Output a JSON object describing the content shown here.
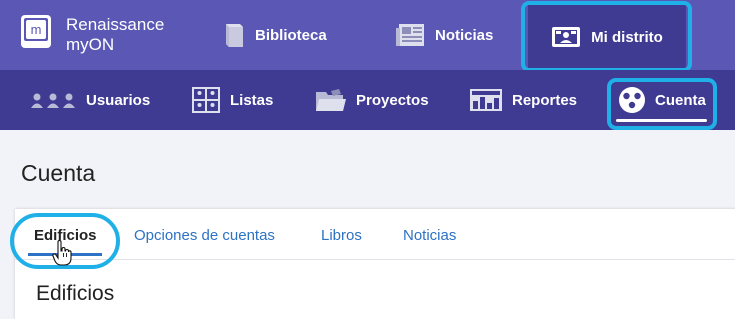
{
  "brand": {
    "line1": "Renaissance",
    "line2": "myON"
  },
  "top_nav": {
    "biblioteca": "Biblioteca",
    "noticias": "Noticias",
    "mi_distrito": "Mi distrito"
  },
  "sub_nav": {
    "usuarios": "Usuarios",
    "listas": "Listas",
    "proyectos": "Proyectos",
    "reportes": "Reportes",
    "cuenta": "Cuenta"
  },
  "page": {
    "title": "Cuenta",
    "tabs": [
      {
        "label": "Edificios",
        "active": true
      },
      {
        "label": "Opciones de cuentas",
        "active": false
      },
      {
        "label": "Libros",
        "active": false
      },
      {
        "label": "Noticias",
        "active": false
      }
    ],
    "section_title": "Edificios"
  },
  "colors": {
    "top_bar": "#5b58b5",
    "sub_bar": "#3f3b93",
    "highlight": "#1fb0e8",
    "link": "#2d72c4"
  },
  "icons": [
    "myon-logo-icon",
    "book-icon",
    "newspaper-icon",
    "district-icon",
    "users-icon",
    "lists-icon",
    "folder-icon",
    "reports-icon",
    "account-icon",
    "hand-cursor-icon"
  ]
}
